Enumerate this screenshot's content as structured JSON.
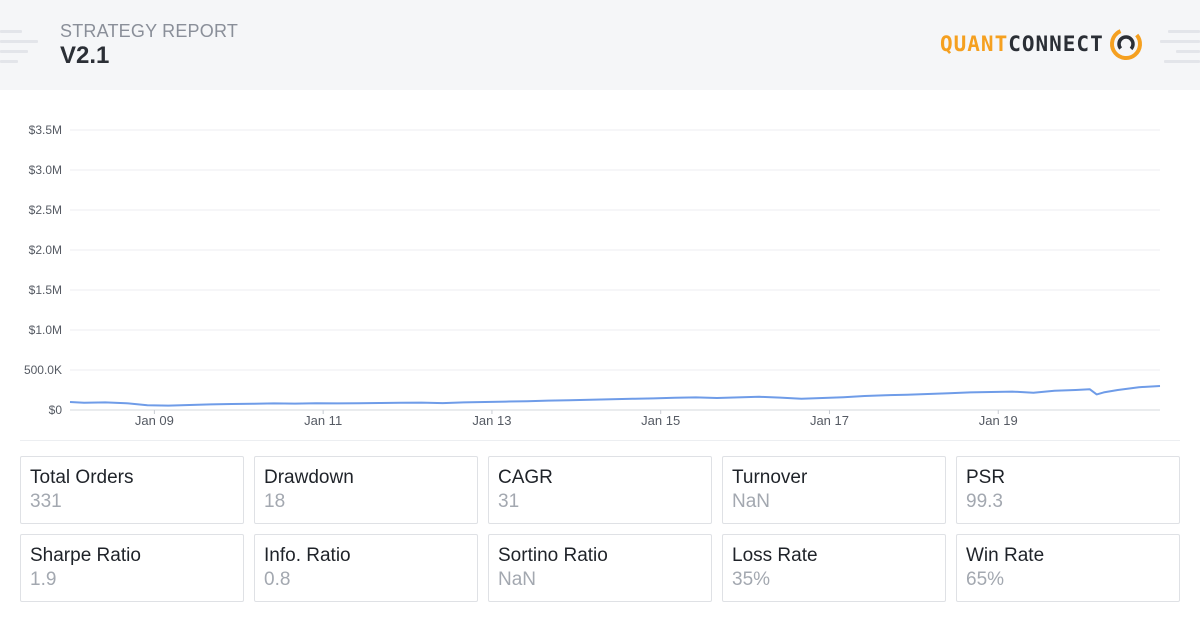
{
  "header": {
    "report_label": "STRATEGY REPORT",
    "version": "V2.1",
    "logo_quant": "QUANT",
    "logo_connect": "CONNECT",
    "accent_color": "#f5a020",
    "logo_icon": "quantconnect-logo-icon"
  },
  "chart_data": {
    "type": "line",
    "title": "",
    "xlabel": "",
    "ylabel": "",
    "x_ticks": [
      "Jan 09",
      "Jan 11",
      "Jan 13",
      "Jan 15",
      "Jan 17",
      "Jan 19"
    ],
    "y_ticks": [
      "$0",
      "500.0K",
      "$1.0M",
      "$1.5M",
      "$2.0M",
      "$2.5M",
      "$3.0M",
      "$3.5M"
    ],
    "xlim": [
      "2008-01",
      "2020-12"
    ],
    "ylim": [
      0,
      3500000
    ],
    "grid": true,
    "line_color": "#6f9ce8",
    "series": [
      {
        "name": "",
        "x": [
          "2008-01",
          "2008-03",
          "2008-06",
          "2008-09",
          "2008-12",
          "2009-03",
          "2009-06",
          "2009-09",
          "2009-12",
          "2010-03",
          "2010-06",
          "2010-09",
          "2010-12",
          "2011-03",
          "2011-06",
          "2011-09",
          "2011-12",
          "2012-03",
          "2012-06",
          "2012-09",
          "2012-12",
          "2013-03",
          "2013-06",
          "2013-09",
          "2013-12",
          "2014-03",
          "2014-06",
          "2014-09",
          "2014-12",
          "2015-03",
          "2015-06",
          "2015-09",
          "2015-12",
          "2016-03",
          "2016-06",
          "2016-09",
          "2016-12",
          "2017-03",
          "2017-06",
          "2017-09",
          "2017-12",
          "2018-03",
          "2018-06",
          "2018-09",
          "2018-12",
          "2019-03",
          "2019-06",
          "2019-09",
          "2019-12",
          "2020-02",
          "2020-03",
          "2020-04",
          "2020-06",
          "2020-09",
          "2020-12"
        ],
        "values": [
          100000,
          90000,
          95000,
          85000,
          60000,
          55000,
          62000,
          70000,
          75000,
          78000,
          82000,
          80000,
          85000,
          82000,
          84000,
          88000,
          90000,
          92000,
          86000,
          95000,
          100000,
          105000,
          110000,
          118000,
          122000,
          128000,
          135000,
          140000,
          145000,
          152000,
          158000,
          150000,
          158000,
          165000,
          155000,
          140000,
          150000,
          160000,
          175000,
          185000,
          190000,
          200000,
          210000,
          220000,
          225000,
          230000,
          215000,
          240000,
          250000,
          260000,
          195000,
          220000,
          250000,
          285000,
          300000
        ]
      }
    ]
  },
  "stats": [
    {
      "label": "Total Orders",
      "value": "331"
    },
    {
      "label": "Drawdown",
      "value": "18"
    },
    {
      "label": "CAGR",
      "value": "31"
    },
    {
      "label": "Turnover",
      "value": "NaN"
    },
    {
      "label": "PSR",
      "value": "99.3"
    },
    {
      "label": "Sharpe Ratio",
      "value": "1.9"
    },
    {
      "label": "Info. Ratio",
      "value": "0.8"
    },
    {
      "label": "Sortino Ratio",
      "value": "NaN"
    },
    {
      "label": "Loss Rate",
      "value": "35%"
    },
    {
      "label": "Win Rate",
      "value": "65%"
    }
  ]
}
